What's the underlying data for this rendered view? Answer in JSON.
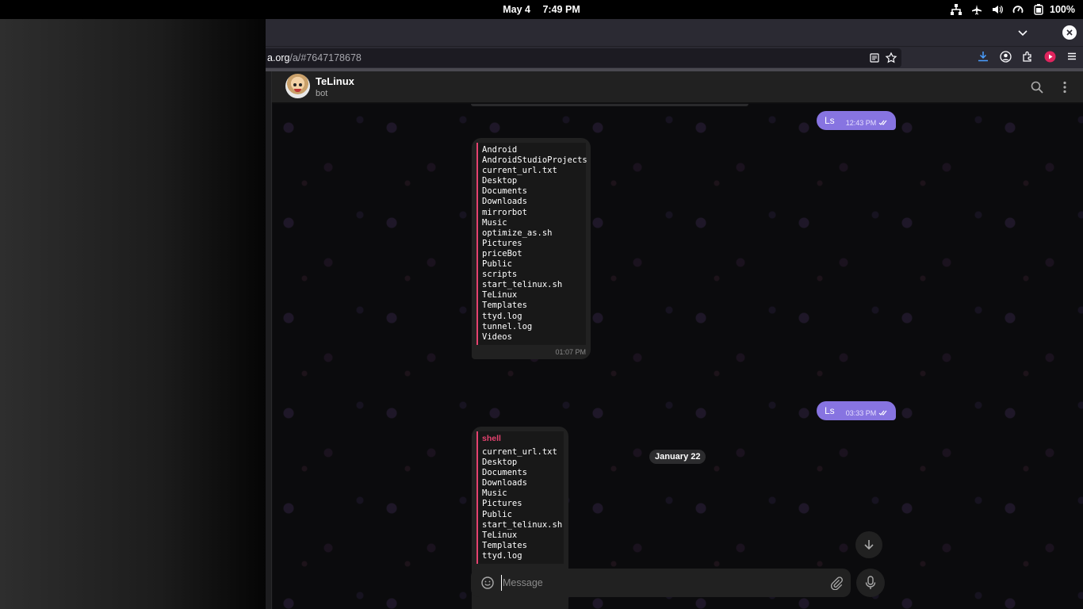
{
  "system_bar": {
    "date": "May 4",
    "time": "7:49 PM",
    "battery": "100%",
    "icons": [
      "network-icon",
      "airplane-mode-icon",
      "volume-icon",
      "power-profile-icon",
      "battery-icon"
    ]
  },
  "browser": {
    "url_prefix": "",
    "url_domain": "a.org",
    "url_path": "/a/#7647178678",
    "toolbar_icons": [
      "download-icon",
      "account-icon",
      "extensions-icon",
      "recorder-icon",
      "menu-icon"
    ]
  },
  "chat": {
    "title": "TeLinux",
    "subtitle": "bot",
    "messages": [
      {
        "direction": "out",
        "text": "Ls",
        "time": "12:43 PM"
      },
      {
        "direction": "in",
        "language": "",
        "lines": [
          "Android",
          "AndroidStudioProjects",
          "current_url.txt",
          "Desktop",
          "Documents",
          "Downloads",
          "mirrorbot",
          "Music",
          "optimize_as.sh",
          "Pictures",
          "priceBot",
          "Public",
          "scripts",
          "start_telinux.sh",
          "TeLinux",
          "Templates",
          "ttyd.log",
          "tunnel.log",
          "Videos"
        ],
        "time": "01:07 PM"
      },
      {
        "direction": "date",
        "text": "January 22"
      },
      {
        "direction": "out",
        "text": "Ls",
        "time": "03:33 PM"
      },
      {
        "direction": "in",
        "language": "shell",
        "lines": [
          "current_url.txt",
          "Desktop",
          "Documents",
          "Downloads",
          "Music",
          "Pictures",
          "Public",
          "start_telinux.sh",
          "TeLinux",
          "Templates",
          "ttyd.log"
        ],
        "time": ""
      }
    ],
    "composer_placeholder": "Message"
  },
  "colors": {
    "accent": "#8774e1",
    "code_border": "#e5426f",
    "bubble_in": "#212121"
  }
}
